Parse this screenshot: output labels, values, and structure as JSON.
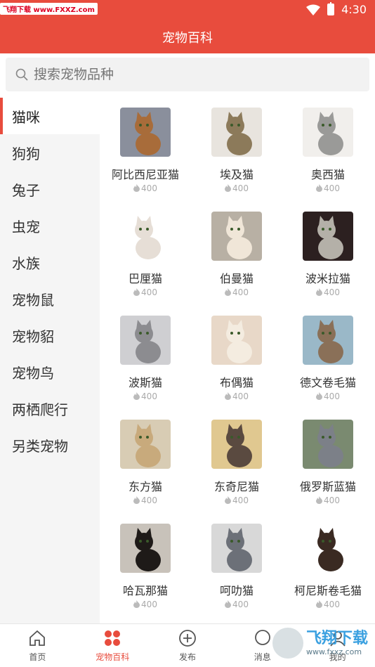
{
  "status_bar": {
    "watermark": "飞翔下载 www.FXXZ.com",
    "time": "4:30"
  },
  "header": {
    "title": "宠物百科"
  },
  "search": {
    "placeholder": "搜索宠物品种"
  },
  "sidebar": {
    "items": [
      {
        "label": "猫咪",
        "active": true
      },
      {
        "label": "狗狗"
      },
      {
        "label": "兔子"
      },
      {
        "label": "虫宠"
      },
      {
        "label": "水族"
      },
      {
        "label": "宠物鼠"
      },
      {
        "label": "宠物貂"
      },
      {
        "label": "宠物鸟"
      },
      {
        "label": "两栖爬行"
      },
      {
        "label": "另类宠物"
      }
    ]
  },
  "breeds": [
    {
      "name": "阿比西尼亚猫",
      "count": "400",
      "bg": "#8a8f9c",
      "cat": "#a86c3a"
    },
    {
      "name": "埃及猫",
      "count": "400",
      "bg": "#e8e4de",
      "cat": "#8c7a5a"
    },
    {
      "name": "奥西猫",
      "count": "400",
      "bg": "#f1efec",
      "cat": "#9a9a98"
    },
    {
      "name": "巴厘猫",
      "count": "400",
      "bg": "#ffffff",
      "cat": "#e6ded6"
    },
    {
      "name": "伯曼猫",
      "count": "400",
      "bg": "#b8b0a4",
      "cat": "#f0e6d8"
    },
    {
      "name": "波米拉猫",
      "count": "400",
      "bg": "#2c2020",
      "cat": "#b4b0a8"
    },
    {
      "name": "波斯猫",
      "count": "400",
      "bg": "#cfcfd2",
      "cat": "#8c8c90"
    },
    {
      "name": "布偶猫",
      "count": "400",
      "bg": "#e8d8c8",
      "cat": "#f4ece0"
    },
    {
      "name": "德文卷毛猫",
      "count": "400",
      "bg": "#9ab8c8",
      "cat": "#8a7058"
    },
    {
      "name": "东方猫",
      "count": "400",
      "bg": "#d8ccb4",
      "cat": "#c8aa7c"
    },
    {
      "name": "东奇尼猫",
      "count": "400",
      "bg": "#e0c890",
      "cat": "#5a4a40"
    },
    {
      "name": "俄罗斯蓝猫",
      "count": "400",
      "bg": "#7a8a70",
      "cat": "#7c8088"
    },
    {
      "name": "哈瓦那猫",
      "count": "400",
      "bg": "#c8c2ba",
      "cat": "#1e1a18"
    },
    {
      "name": "呵叻猫",
      "count": "400",
      "bg": "#d8d8d8",
      "cat": "#6c7078"
    },
    {
      "name": "柯尼斯卷毛猫",
      "count": "400",
      "bg": "#ffffff",
      "cat": "#3a2a22"
    }
  ],
  "bottom_nav": [
    {
      "label": "首页",
      "icon": "home-icon"
    },
    {
      "label": "宠物百科",
      "icon": "encyclopedia-icon",
      "active": true
    },
    {
      "label": "发布",
      "icon": "add-circle-icon"
    },
    {
      "label": "消息",
      "icon": "message-icon"
    },
    {
      "label": "我的",
      "icon": "profile-icon"
    }
  ],
  "watermark_bottom": {
    "title": "飞翔下载",
    "url": "www.fxxz.com"
  },
  "colors": {
    "accent": "#e84c3d",
    "sidebar_bg": "#f5f5f5"
  }
}
